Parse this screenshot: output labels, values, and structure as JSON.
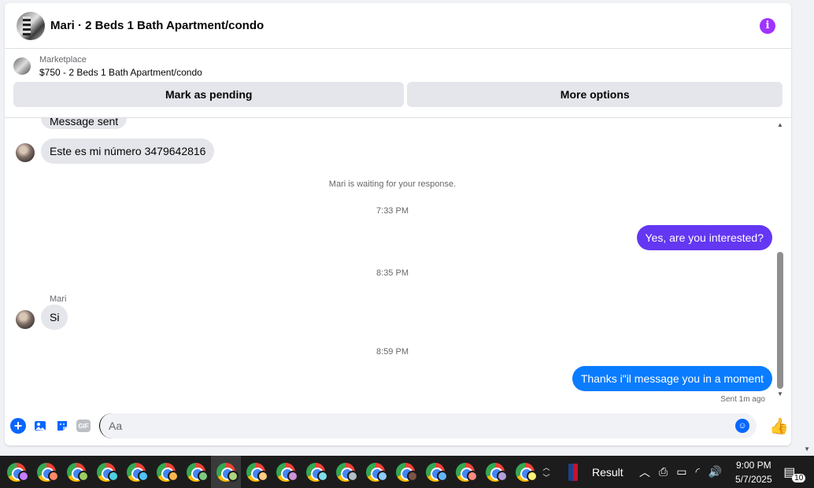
{
  "header": {
    "title": "Mari · 2 Beds 1 Bath Apartment/condo",
    "info_icon": "i"
  },
  "listing": {
    "category": "Marketplace",
    "price_title": "$750 - 2 Beds 1 Bath Apartment/condo",
    "mark_pending_label": "Mark as pending",
    "more_options_label": "More options"
  },
  "messages": {
    "partial_message": "Message sent",
    "number_message": "Este es mi número 3479642816",
    "waiting_notice": "Mari is waiting for your response.",
    "time1": "7:33 PM",
    "out_message1": "Yes, are you interested?",
    "time2": "8:35 PM",
    "sender_name": "Mari",
    "in_message2": "Si",
    "time3": "8:59 PM",
    "out_message2": "Thanks i\"il message you in a moment",
    "sent_status": "Sent 1m ago"
  },
  "composer": {
    "placeholder": "Aa",
    "plus_icon": "+",
    "gif_label": "GIF",
    "emoji_icon": "☺",
    "like_icon": "👍"
  },
  "taskbar": {
    "result_label": "Result",
    "time": "9:00 PM",
    "date": "5/7/2025",
    "notification_count": "10",
    "app_profile_colors": [
      "#c77dff",
      "#ff8a65",
      "#9ccc65",
      "#4dd0e1",
      "#4fc3f7",
      "#ffb74d",
      "#81c784",
      "#aed581",
      "#ffcc80",
      "#ce93d8",
      "#80deea",
      "#b0bec5",
      "#90caf9",
      "#795548",
      "#64b5f6",
      "#ff8a80",
      "#b39ddb",
      "#fff176"
    ],
    "active_index": 7
  },
  "colors": {
    "accent_blue": "#0a7cff",
    "accent_purple": "#6437f2",
    "info_purple": "#a033ff",
    "incoming_bg": "#e4e6eb"
  }
}
